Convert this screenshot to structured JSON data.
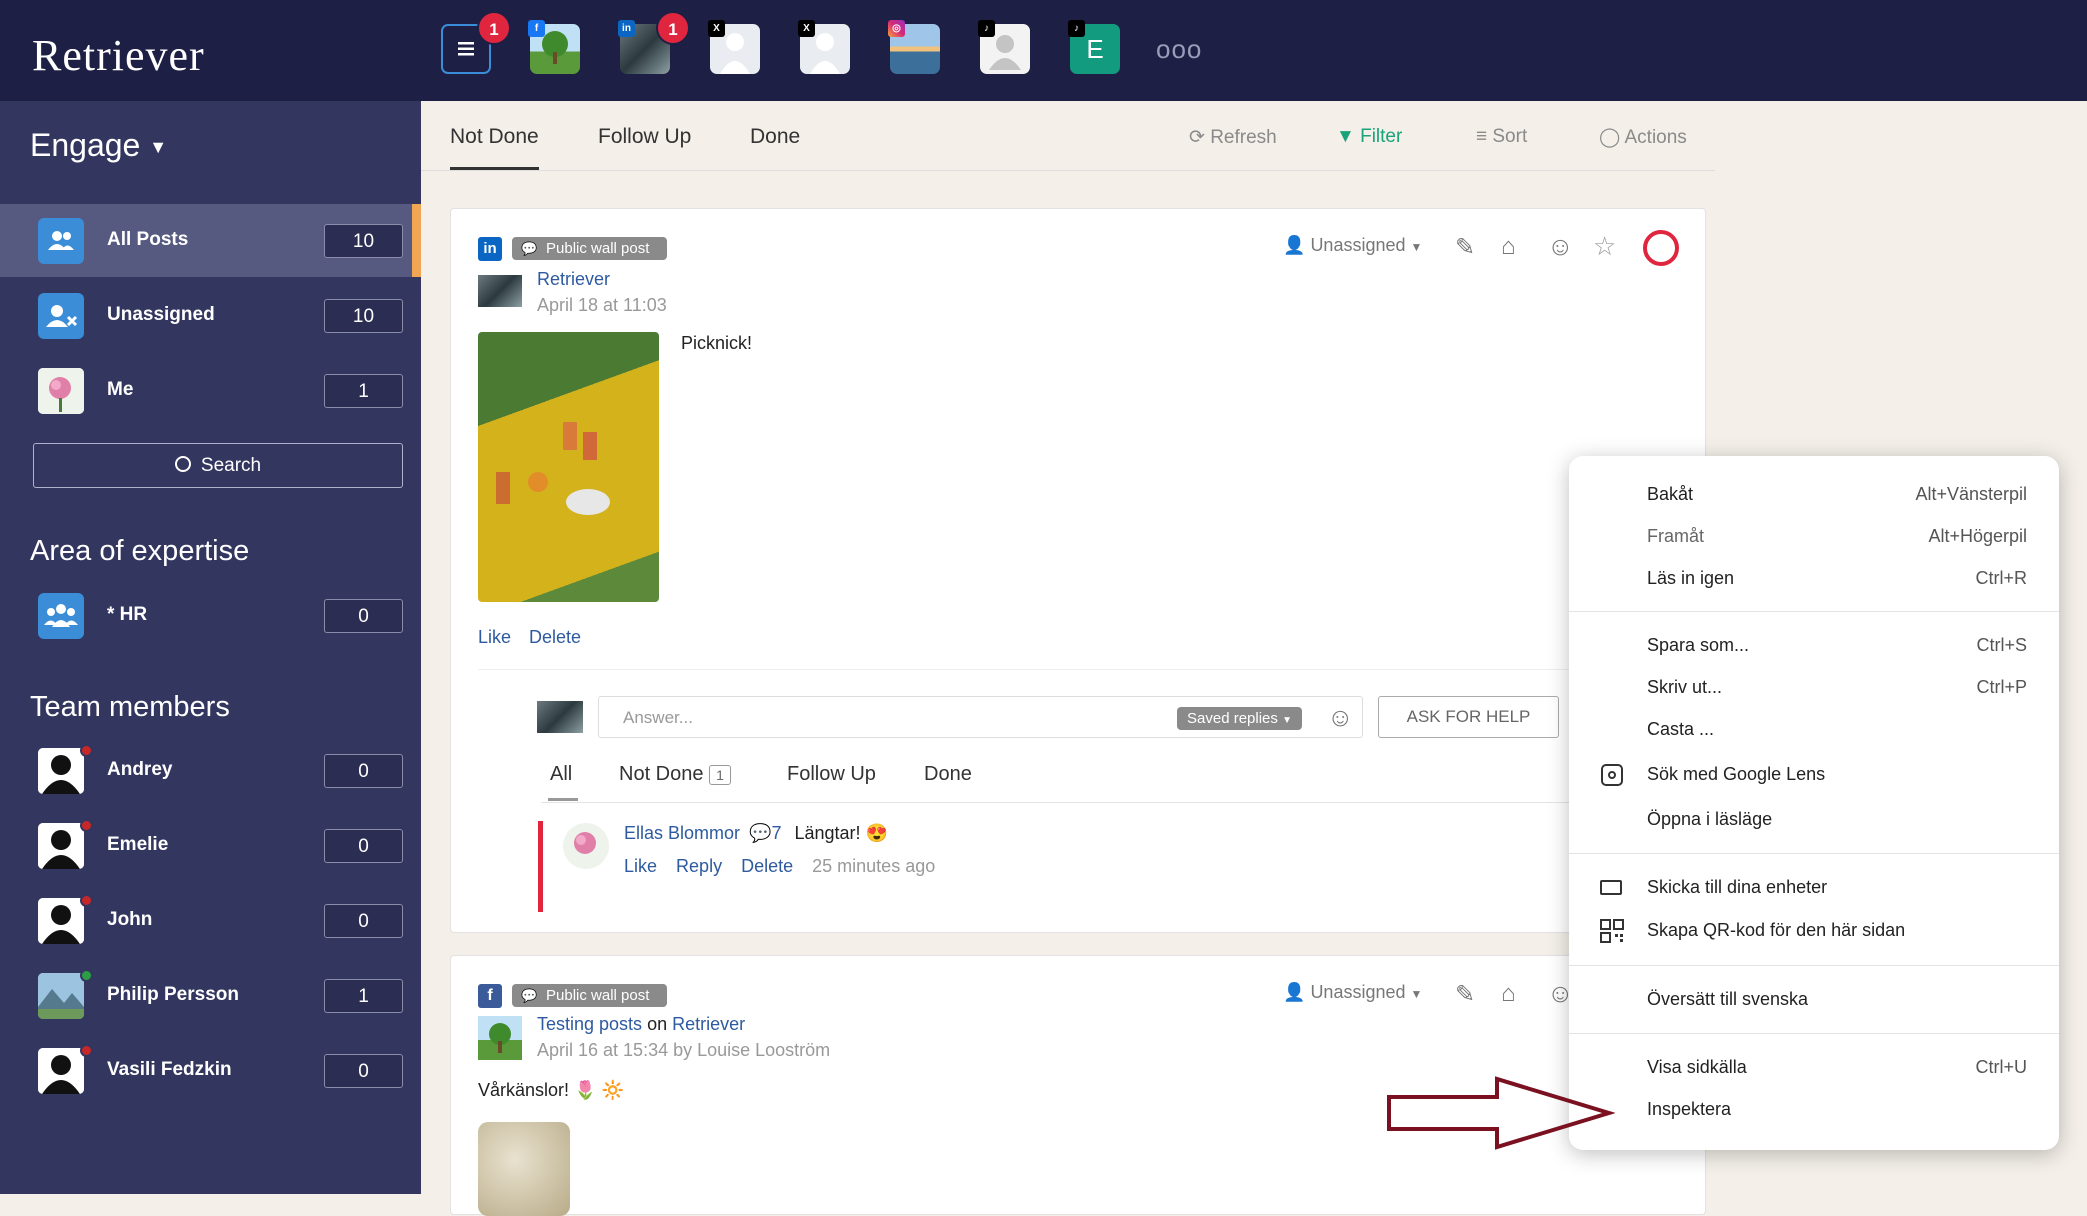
{
  "app": {
    "logo": "Retriever"
  },
  "channels": [
    {
      "icon": "list-icon",
      "badge": "1"
    },
    {
      "icon": "facebook-tree-avatar"
    },
    {
      "icon": "linkedin-avatar",
      "badge": "1"
    },
    {
      "icon": "x-avatar-1"
    },
    {
      "icon": "x-avatar-2"
    },
    {
      "icon": "instagram-avatar"
    },
    {
      "icon": "tiktok-avatar"
    },
    {
      "icon": "e-avatar",
      "letter": "E"
    },
    {
      "icon": "more-icon",
      "label": "ooo"
    }
  ],
  "sidebar": {
    "title": "Engage",
    "items": [
      {
        "label": "All Posts",
        "count": "10"
      },
      {
        "label": "Unassigned",
        "count": "10"
      },
      {
        "label": "Me",
        "count": "1"
      }
    ],
    "search_label": "Search",
    "area_title": "Area of expertise",
    "areas": [
      {
        "label": "* HR",
        "count": "0"
      }
    ],
    "team_title": "Team members",
    "members": [
      {
        "label": "Andrey",
        "count": "0",
        "status": "#c62828"
      },
      {
        "label": "Emelie",
        "count": "0",
        "status": "#c62828"
      },
      {
        "label": "John",
        "count": "0",
        "status": "#c62828"
      },
      {
        "label": "Philip Persson",
        "count": "1",
        "status": "#2e9e44"
      },
      {
        "label": "Vasili Fedzkin",
        "count": "0",
        "status": "#c62828"
      }
    ]
  },
  "tabs": {
    "not_done": "Not Done",
    "follow_up": "Follow Up",
    "done": "Done"
  },
  "tools": {
    "refresh": "Refresh",
    "filter": "Filter",
    "sort": "Sort",
    "actions": "Actions"
  },
  "post1": {
    "type": "Public wall post",
    "author": "Retriever",
    "date": "April 18 at 11:03",
    "assignee": "Unassigned",
    "text": "Picknick!",
    "like": "Like",
    "delete": "Delete",
    "answer_placeholder": "Answer...",
    "saved_replies": "Saved replies",
    "ask_help": "ASK FOR HELP",
    "subtabs": {
      "all": "All",
      "not_done": "Not Done",
      "not_done_count": "1",
      "follow_up": "Follow Up",
      "done": "Done"
    },
    "comment": {
      "author": "Ellas Blommor",
      "reply_count": "7",
      "text": "Längtar!",
      "emoji": "😍",
      "like": "Like",
      "reply": "Reply",
      "delete": "Delete",
      "time": "25 minutes ago"
    }
  },
  "post2": {
    "type": "Public wall post",
    "author": "Testing posts",
    "on": "on",
    "page": "Retriever",
    "date": "April 16 at 15:34 by Louise Looström",
    "assignee": "Unassigned",
    "text": "Vårkänslor! 🌷 🔆"
  },
  "context_menu": [
    {
      "label": "Bakåt",
      "shortcut": "Alt+Vänsterpil"
    },
    {
      "label": "Framåt",
      "shortcut": "Alt+Högerpil",
      "disabled": true
    },
    {
      "label": "Läs in igen",
      "shortcut": "Ctrl+R"
    },
    {
      "label": "Spara som...",
      "shortcut": "Ctrl+S"
    },
    {
      "label": "Skriv ut...",
      "shortcut": "Ctrl+P"
    },
    {
      "label": "Casta ...",
      "shortcut": ""
    },
    {
      "label": "Sök med Google Lens",
      "shortcut": "",
      "icon": "google-lens-icon"
    },
    {
      "label": "Öppna i läsläge",
      "shortcut": ""
    },
    {
      "label": "Skicka till dina enheter",
      "shortcut": "",
      "icon": "devices-icon"
    },
    {
      "label": "Skapa QR-kod för den här sidan",
      "shortcut": "",
      "icon": "qr-code-icon"
    },
    {
      "label": "Översätt till svenska",
      "shortcut": ""
    },
    {
      "label": "Visa sidkälla",
      "shortcut": "Ctrl+U"
    },
    {
      "label": "Inspektera",
      "shortcut": ""
    }
  ],
  "colors": {
    "topbar": "#1d1f45",
    "sidebar": "#33365f",
    "accent": "#e0263f",
    "filter": "#1aa37a",
    "link": "#2d5aa0",
    "arrow": "#7a1020"
  }
}
